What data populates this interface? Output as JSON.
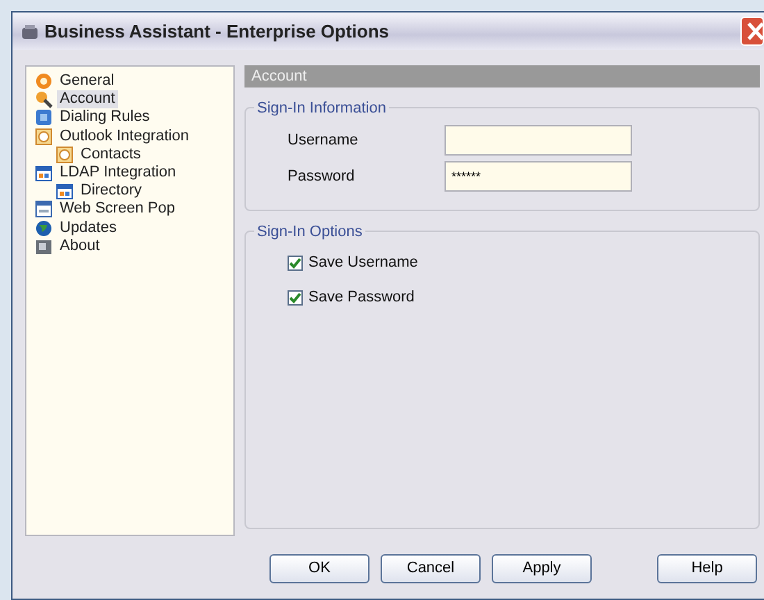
{
  "window": {
    "title": "Business Assistant - Enterprise Options"
  },
  "sidebar": {
    "items": [
      {
        "label": "General",
        "selected": false
      },
      {
        "label": "Account",
        "selected": true
      },
      {
        "label": "Dialing Rules",
        "selected": false
      },
      {
        "label": "Outlook Integration",
        "selected": false,
        "children": [
          {
            "label": "Contacts",
            "selected": false
          }
        ]
      },
      {
        "label": "LDAP Integration",
        "selected": false,
        "children": [
          {
            "label": "Directory",
            "selected": false
          }
        ]
      },
      {
        "label": "Web Screen Pop",
        "selected": false
      },
      {
        "label": "Updates",
        "selected": false
      },
      {
        "label": "About",
        "selected": false
      }
    ]
  },
  "panel": {
    "title": "Account",
    "sign_in_information": {
      "title": "Sign-In Information",
      "fields": [
        {
          "label": "Username"
        },
        {
          "label": "Password",
          "value": "******"
        }
      ]
    },
    "sign_in_options": {
      "title": "Sign-In Options",
      "checkboxes": [
        {
          "label": "Save Username",
          "checked": true
        },
        {
          "label": "Save Password",
          "checked": true
        }
      ]
    }
  },
  "buttons": [
    "OK",
    "Cancel",
    "Apply",
    "Help"
  ]
}
